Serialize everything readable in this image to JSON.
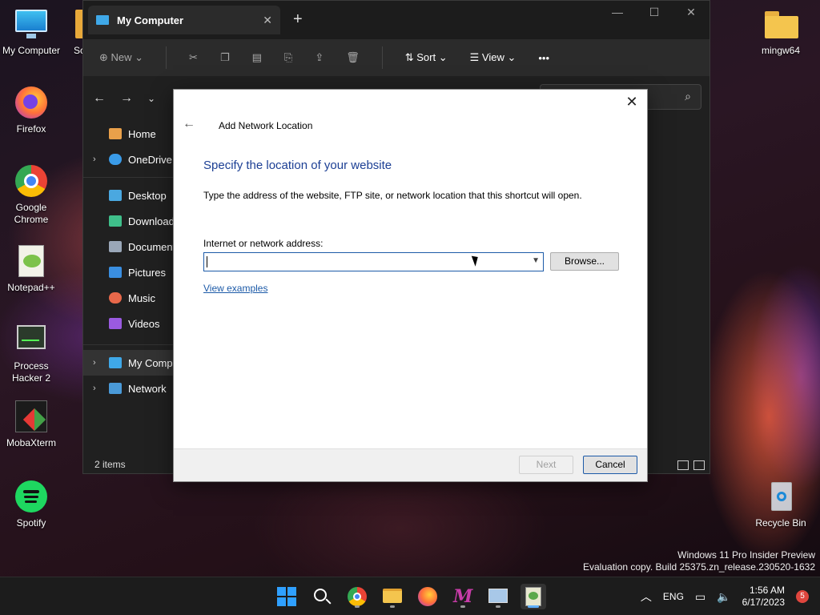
{
  "desktop": {
    "icons": [
      {
        "label": "My Computer",
        "icon": "monitor-icon"
      },
      {
        "label": "Firefox",
        "icon": "firefox-icon"
      },
      {
        "label": "Google Chrome",
        "icon": "chrome-icon"
      },
      {
        "label": "Notepad++",
        "icon": "notepadpp-icon"
      },
      {
        "label": "Process Hacker 2",
        "icon": "process-hacker-icon"
      },
      {
        "label": "MobaXterm",
        "icon": "mobaxterm-icon"
      },
      {
        "label": "Spotify",
        "icon": "spotify-icon"
      },
      {
        "label": "mingw64",
        "icon": "folder-icon"
      },
      {
        "label": "Recycle Bin",
        "icon": "recycle-bin-icon"
      },
      {
        "label": "Sc",
        "icon": "folder-icon"
      }
    ]
  },
  "explorer": {
    "tab_title": "My Computer",
    "toolbar": {
      "new_label": "New",
      "sort_label": "Sort",
      "view_label": "View",
      "more_label": "•••"
    },
    "nav": [
      {
        "label": "Home",
        "icon": "home-icon"
      },
      {
        "label": "OneDrive",
        "icon": "cloud-icon"
      },
      {
        "label": "Desktop",
        "icon": "desktop-icon"
      },
      {
        "label": "Downloads",
        "icon": "download-icon"
      },
      {
        "label": "Documents",
        "icon": "documents-icon"
      },
      {
        "label": "Pictures",
        "icon": "pictures-icon"
      },
      {
        "label": "Music",
        "icon": "music-icon"
      },
      {
        "label": "Videos",
        "icon": "videos-icon"
      },
      {
        "label": "My Computer",
        "icon": "monitor-icon"
      },
      {
        "label": "Network",
        "icon": "network-icon"
      }
    ],
    "status": "2 items"
  },
  "dialog": {
    "title": "Add Network Location",
    "heading": "Specify the location of your website",
    "description": "Type the address of the website, FTP site, or network location that this shortcut will open.",
    "address_label": "Internet or network address:",
    "address_value": "",
    "browse_label": "Browse...",
    "examples_link": "View examples",
    "next_label": "Next",
    "cancel_label": "Cancel"
  },
  "watermark": {
    "line1": "Windows 11 Pro Insider Preview",
    "line2": "Evaluation copy. Build 25375.zn_release.230520-1632"
  },
  "taskbar": {
    "lang": "ENG",
    "time": "1:56 AM",
    "date": "6/17/2023",
    "notifications": "5"
  },
  "colors": {
    "accent_blue": "#1c5aa8",
    "heading_blue": "#1c3f94",
    "explorer_bg": "#202020"
  }
}
